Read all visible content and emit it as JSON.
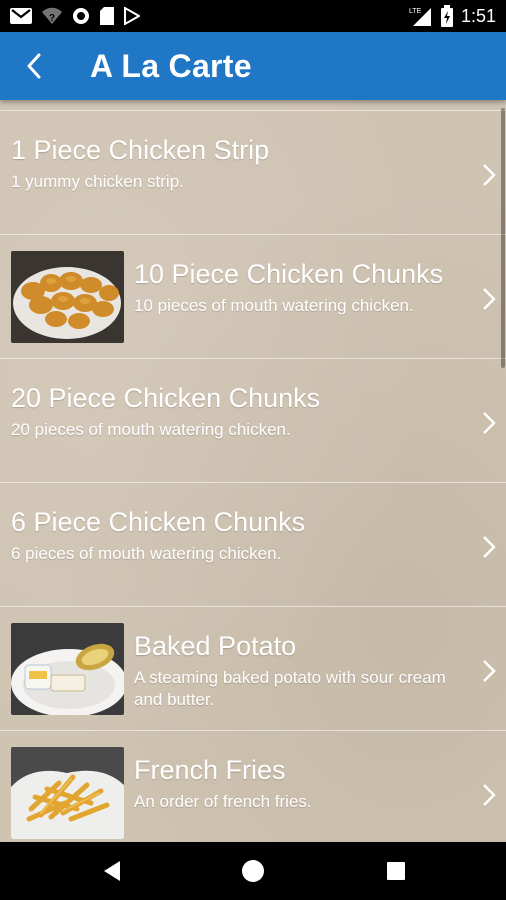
{
  "status_bar": {
    "time": "1:51",
    "left_icons": [
      "gmail-icon",
      "wifi-question-icon",
      "circle-icon",
      "sd-card-icon",
      "play-store-icon"
    ],
    "right_icons": [
      "lte-signal-icon",
      "battery-icon"
    ],
    "network_label": "LTE"
  },
  "app_bar": {
    "title": "A La Carte",
    "back_icon": "back-arrow-icon",
    "color": "#1f77c6"
  },
  "items": [
    {
      "name": "1 Piece Chicken Strip",
      "desc": "1 yummy chicken strip.",
      "has_image": false
    },
    {
      "name": "10 Piece Chicken Chunks",
      "desc": "10 pieces of mouth watering chicken.",
      "has_image": true,
      "image": "chicken-chunks-photo"
    },
    {
      "name": "20 Piece Chicken Chunks",
      "desc": "20 pieces of mouth watering chicken.",
      "has_image": false
    },
    {
      "name": "6 Piece Chicken Chunks",
      "desc": "6 pieces of mouth watering chicken.",
      "has_image": false
    },
    {
      "name": "Baked Potato",
      "desc": "A steaming baked potato with sour cream and butter.",
      "has_image": true,
      "image": "baked-potato-photo"
    },
    {
      "name": "French Fries",
      "desc": "An order of french fries.",
      "has_image": true,
      "image": "french-fries-photo"
    }
  ],
  "nav_bar": {
    "buttons": [
      "back-triangle-icon",
      "home-circle-icon",
      "recents-square-icon"
    ]
  }
}
